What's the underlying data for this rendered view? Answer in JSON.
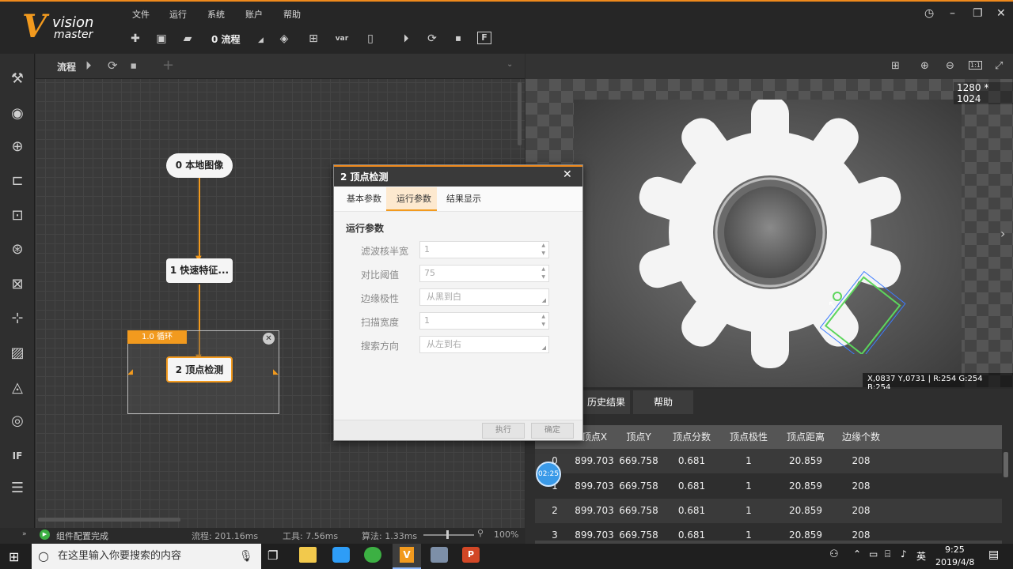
{
  "app": {
    "logo_v": "V",
    "logo_line1": "vision",
    "logo_line2": "master"
  },
  "menu": [
    "文件",
    "运行",
    "系统",
    "账户",
    "帮助"
  ],
  "toolbar": {
    "flow_count": "0 流程"
  },
  "flow": {
    "header_label": "流程",
    "nodes": [
      "0 本地图像",
      "1 快速特征...",
      "2 顶点检测"
    ],
    "loop_label": "1.0 循环"
  },
  "image": {
    "resolution": "1280 * 1024",
    "coords": "X,0837 Y,0731 | R:254 G:254 B:254"
  },
  "results": {
    "tabs": [
      "历史结果",
      "帮助"
    ],
    "columns": [
      "",
      "顶点X",
      "顶点Y",
      "顶点分数",
      "顶点极性",
      "顶点距离",
      "边缘个数"
    ],
    "rows": [
      [
        "0",
        "899.703",
        "669.758",
        "0.681",
        "1",
        "20.859",
        "208"
      ],
      [
        "1",
        "899.703",
        "669.758",
        "0.681",
        "1",
        "20.859",
        "208"
      ],
      [
        "2",
        "899.703",
        "669.758",
        "0.681",
        "1",
        "20.859",
        "208"
      ],
      [
        "3",
        "899.703",
        "669.758",
        "0.681",
        "1",
        "20.859",
        "208"
      ]
    ],
    "timer_badge": "02:25"
  },
  "status": {
    "message": "组件配置完成",
    "flow_time": "流程: 201.16ms",
    "tool_time": "工具: 7.56ms",
    "algo_time": "算法: 1.33ms",
    "zoom": "100%"
  },
  "dialog": {
    "title": "2 顶点检测",
    "tabs": [
      "基本参数",
      "运行参数",
      "结果显示"
    ],
    "section": "运行参数",
    "params": [
      {
        "label": "滤波核半宽",
        "value": "1"
      },
      {
        "label": "对比阈值",
        "value": "75"
      },
      {
        "label": "边缘极性",
        "value": "从黑到白"
      },
      {
        "label": "扫描宽度",
        "value": "1"
      },
      {
        "label": "搜索方向",
        "value": "从左到右"
      }
    ],
    "execute_label": "执行",
    "confirm_label": "确定"
  },
  "taskbar": {
    "search_placeholder": "在这里输入你要搜索的内容",
    "time": "9:25",
    "date": "2019/4/8",
    "ime": "英"
  },
  "colors": {
    "accent": "#f29a1e",
    "green_box": "#5cd65c",
    "blue_box": "#3b7bff"
  }
}
